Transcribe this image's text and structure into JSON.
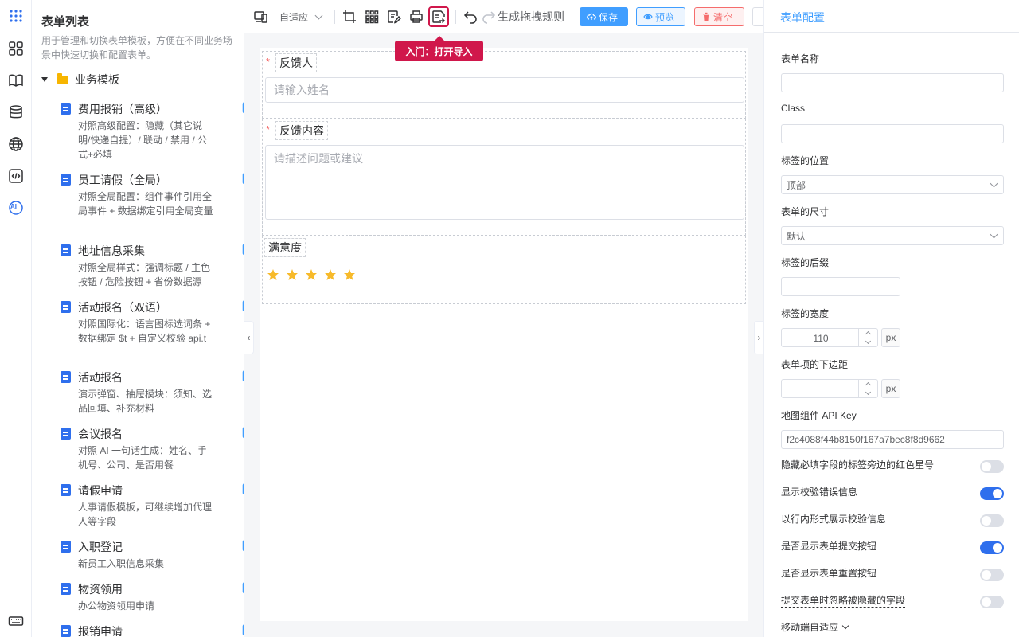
{
  "rail": {
    "icons": [
      "apps-grid-icon",
      "widgets-icon",
      "book-icon",
      "database-icon",
      "globe-icon",
      "code-icon",
      "ai-icon",
      "keyboard-icon"
    ],
    "ai_label": "AI",
    "accent": "#2f6fed"
  },
  "list_panel": {
    "title": "表单列表",
    "description": "用于管理和切换表单模板，方便在不同业务场景中快速切换和配置表单。",
    "folder": "业务模板",
    "templates": [
      {
        "name": "费用报销（高级）",
        "desc": "对照高级配置：隐藏（其它说明/快递自提）/ 联动 / 禁用 / 公式+必填"
      },
      {
        "name": "员工请假（全局）",
        "desc": "对照全局配置：组件事件引用全局事件 + 数据绑定引用全局变量"
      },
      {
        "name": "地址信息采集",
        "desc": "对照全局样式：强调标题 / 主色按钮 / 危险按钮 + 省份数据源"
      },
      {
        "name": "活动报名（双语）",
        "desc": "对照国际化：语言图标选词条 + 数据绑定 $t + 自定义校验 api.t"
      },
      {
        "name": "活动报名",
        "desc": "演示弹窗、抽屉模块：须知、选品回填、补充材料"
      },
      {
        "name": "会议报名",
        "desc": "对照 AI 一句话生成：姓名、手机号、公司、是否用餐"
      },
      {
        "name": "请假申请",
        "desc": "人事请假模板，可继续增加代理人等字段"
      },
      {
        "name": "入职登记",
        "desc": "新员工入职信息采集"
      },
      {
        "name": "物资领用",
        "desc": "办公物资领用申请"
      },
      {
        "name": "报销申请",
        "desc": ""
      }
    ]
  },
  "toolbar": {
    "device_select": "自适应",
    "generate_rule": "生成拖拽规则",
    "save_label": "保存",
    "preview_label": "预览",
    "clear_label": "清空",
    "tooltip": "入门：打开导入",
    "colors": {
      "primary": "#409eff",
      "danger": "#f56c6c",
      "highlight": "#d0174b"
    }
  },
  "canvas": {
    "fields": [
      {
        "label": "反馈人",
        "required": true,
        "placeholder": "请输入姓名",
        "type": "input"
      },
      {
        "label": "反馈内容",
        "required": true,
        "placeholder": "请描述问题或建议",
        "type": "textarea"
      },
      {
        "label": "满意度",
        "required": false,
        "type": "rate",
        "stars": 5
      }
    ],
    "required_mark": "*"
  },
  "config": {
    "tab": "表单配置",
    "form_name_label": "表单名称",
    "form_name_value": "",
    "class_label": "Class",
    "class_value": "",
    "label_position_label": "标签的位置",
    "label_position_value": "顶部",
    "form_size_label": "表单的尺寸",
    "form_size_value": "默认",
    "label_suffix_label": "标签的后缀",
    "label_suffix_value": "",
    "label_width_label": "标签的宽度",
    "label_width_value": "110",
    "label_width_unit": "px",
    "item_margin_label": "表单项的下边距",
    "item_margin_value": "",
    "item_margin_unit": "px",
    "map_key_label": "地图组件 API Key",
    "map_key_value": "f2c4088f44b8150f167a7bec8f8d9662",
    "switches": [
      {
        "label": "隐藏必填字段的标签旁边的红色星号",
        "on": false
      },
      {
        "label": "显示校验错误信息",
        "on": true
      },
      {
        "label": "以行内形式展示校验信息",
        "on": false
      },
      {
        "label": "是否显示表单提交按钮",
        "on": true
      },
      {
        "label": "是否显示表单重置按钮",
        "on": false
      },
      {
        "label": "提交表单时忽略被隐藏的字段",
        "on": false
      }
    ],
    "mobile_adaptive": "移动端自适应"
  }
}
